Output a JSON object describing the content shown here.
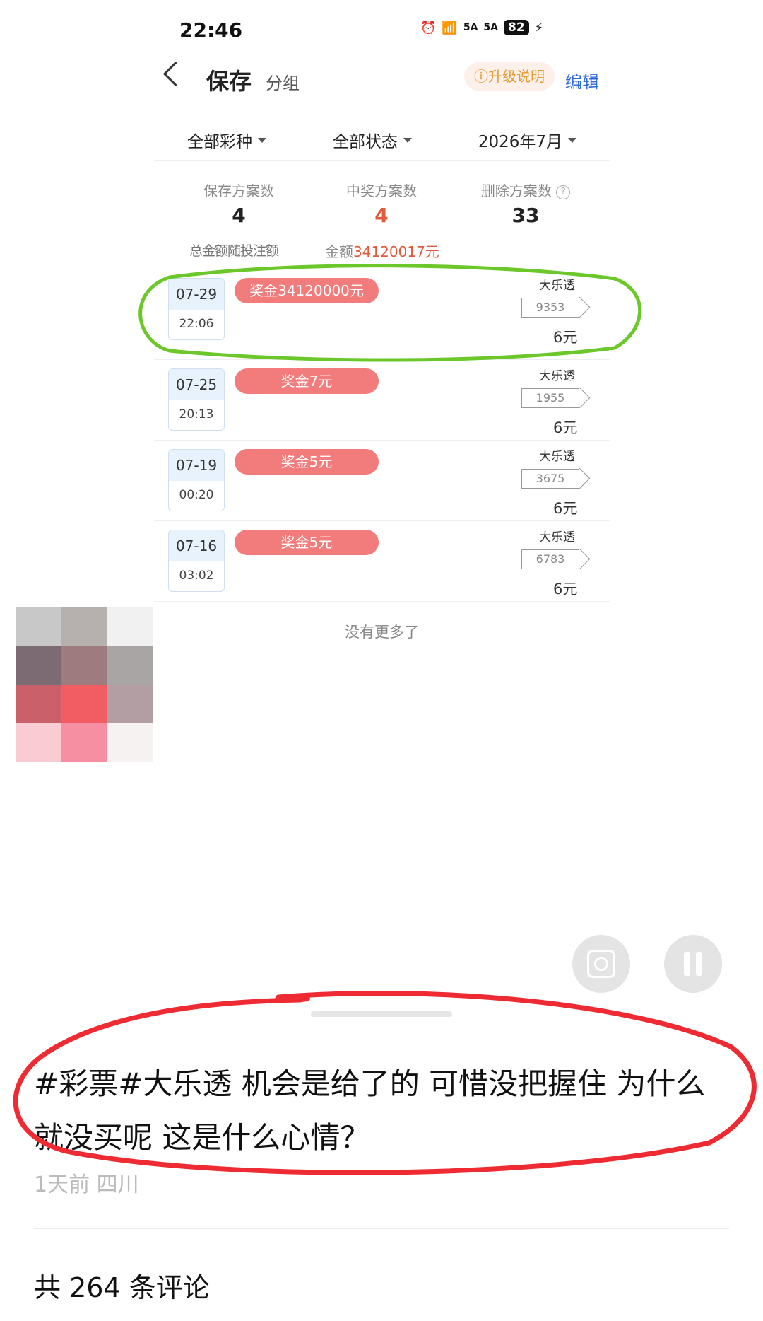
{
  "status_bar": {
    "time": "22:46",
    "signal1": "5A",
    "signal2": "5A",
    "battery": "82"
  },
  "nav": {
    "title": "保存",
    "group": "分组",
    "upgrade": "ⓘ升级说明",
    "edit": "编辑"
  },
  "filters": [
    "全部彩种",
    "全部状态",
    "2026年7月"
  ],
  "stats": {
    "saved": {
      "label": "保存方案数",
      "value": "4"
    },
    "won": {
      "label": "中奖方案数",
      "value": "4"
    },
    "deleted": {
      "label": "删除方案数",
      "value": "33"
    },
    "sub_left": "总金额随投注额",
    "amount_label": "金额",
    "amount_value": "34120017元"
  },
  "records": [
    {
      "date": "07-29",
      "time": "22:06",
      "prize": "奖金34120000元",
      "lottery": "大乐透",
      "ticket": "9353",
      "price": "6元"
    },
    {
      "date": "07-25",
      "time": "20:13",
      "prize": "奖金7元",
      "lottery": "大乐透",
      "ticket": "1955",
      "price": "6元"
    },
    {
      "date": "07-19",
      "time": "00:20",
      "prize": "奖金5元",
      "lottery": "大乐透",
      "ticket": "3675",
      "price": "6元"
    },
    {
      "date": "07-16",
      "time": "03:02",
      "prize": "奖金5元",
      "lottery": "大乐透",
      "ticket": "6783",
      "price": "6元"
    }
  ],
  "no_more": "没有更多了",
  "post": {
    "caption": "#彩票#大乐透 机会是给了的 可惜没把握住  为什么就没买呢  这是什么心情？",
    "meta": "1天前 四川",
    "comments": "共 264 条评论"
  },
  "colors": {
    "annotation_green": "#6cc72b",
    "annotation_red": "#ee2a32",
    "prize_pill": "#f27b7b",
    "accent_blue": "#2f6bd8"
  }
}
